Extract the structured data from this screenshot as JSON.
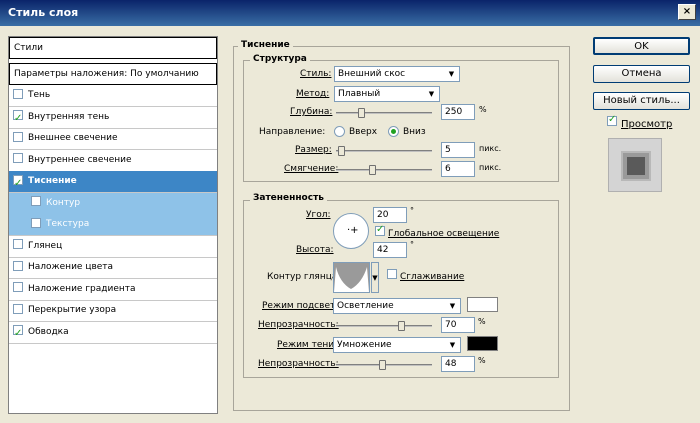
{
  "window": {
    "title": "Стиль слоя",
    "close_glyph": "×"
  },
  "left_panel": {
    "header": "Стили",
    "blending": "Параметры наложения: По умолчанию",
    "items": [
      {
        "label": "Тень",
        "checked": false
      },
      {
        "label": "Внутренняя тень",
        "checked": true
      },
      {
        "label": "Внешнее свечение",
        "checked": false
      },
      {
        "label": "Внутреннее свечение",
        "checked": false
      },
      {
        "label": "Тиснение",
        "checked": true
      },
      {
        "label": "Контур",
        "checked": false
      },
      {
        "label": "Текстура",
        "checked": false
      },
      {
        "label": "Глянец",
        "checked": false
      },
      {
        "label": "Наложение цвета",
        "checked": false
      },
      {
        "label": "Наложение градиента",
        "checked": false
      },
      {
        "label": "Перекрытие узора",
        "checked": false
      },
      {
        "label": "Обводка",
        "checked": true
      }
    ]
  },
  "emboss": {
    "title": "Тиснение",
    "structure": {
      "title": "Структура",
      "style_label": "Стиль:",
      "style_value": "Внешний скос",
      "method_label": "Метод:",
      "method_value": "Плавный",
      "depth_label": "Глубина:",
      "depth_value": "250",
      "depth_unit": "%",
      "depth_level": 0.25,
      "direction_label": "Направление:",
      "up_label": "Вверх",
      "down_label": "Вниз",
      "direction_selected": "down",
      "size_label": "Размер:",
      "size_value": "5",
      "size_unit": "пикс.",
      "size_level": 0.02,
      "soften_label": "Смягчение:",
      "soften_value": "6",
      "soften_unit": "пикс.",
      "soften_level": 0.37
    },
    "shading": {
      "title": "Затененность",
      "angle_label": "Угол:",
      "angle_value": "20",
      "angle_unit": "°",
      "global_light_label": "Глобальное освещение",
      "global_light_checked": true,
      "altitude_label": "Высота:",
      "altitude_value": "42",
      "altitude_unit": "°",
      "gloss_label": "Контур глянца:",
      "antialias_label": "Сглаживание",
      "antialias_checked": false,
      "highlight_mode_label": "Режим подсветки:",
      "highlight_mode_value": "Осветление",
      "highlight_color": "#ffffff",
      "highlight_opacity_label": "Непрозрачность:",
      "highlight_opacity_value": "70",
      "highlight_opacity_unit": "%",
      "highlight_opacity_level": 0.7,
      "shadow_mode_label": "Режим тени:",
      "shadow_mode_value": "Умножение",
      "shadow_color": "#000000",
      "shadow_opacity_label": "Непрозрачность:",
      "shadow_opacity_value": "48",
      "shadow_opacity_unit": "%",
      "shadow_opacity_level": 0.48
    }
  },
  "buttons": {
    "ok": "OK",
    "cancel": "Отмена",
    "new_style": "Новый стиль...",
    "preview_label": "Просмотр",
    "preview_checked": true
  },
  "colors": {
    "selected_row": "#3d86c6",
    "sub_row": "#8ec2e8",
    "dialog_bg": "#ece9d8"
  }
}
